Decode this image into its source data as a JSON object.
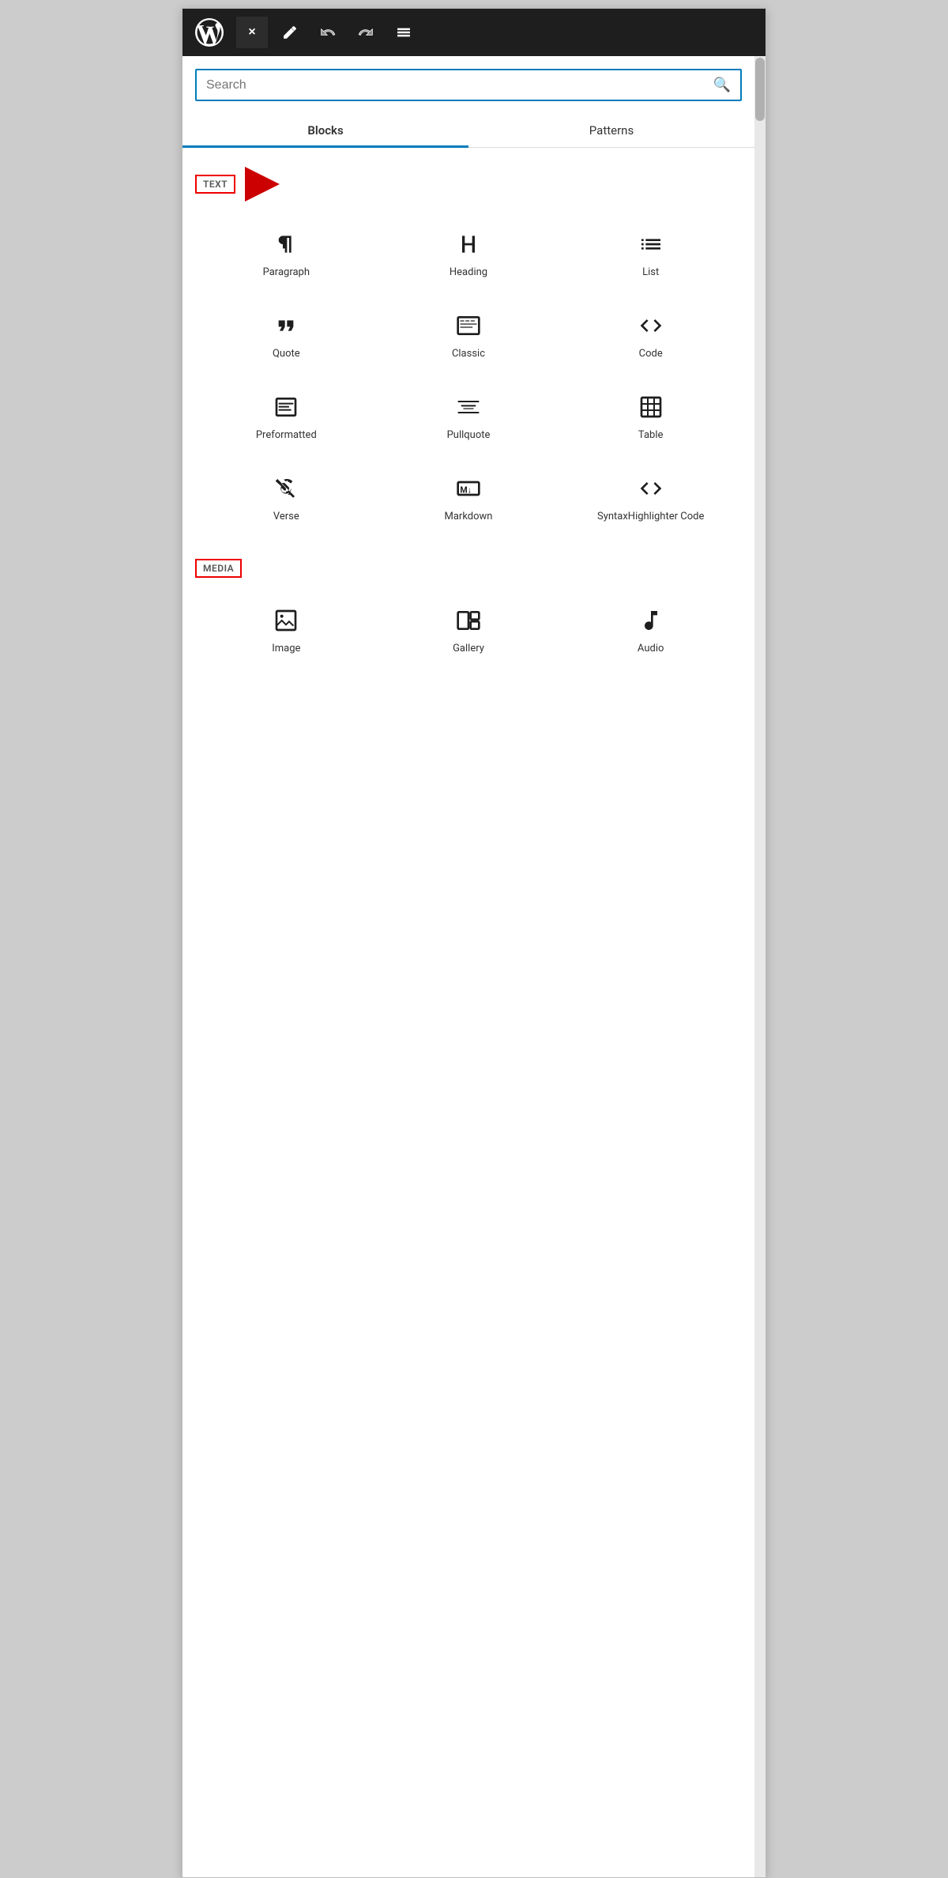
{
  "toolbar": {
    "close_label": "×",
    "pencil_icon": "✏",
    "undo_icon": "↩",
    "redo_icon": "↪",
    "menu_icon": "≡"
  },
  "search": {
    "placeholder": "Search",
    "icon": "⌕"
  },
  "tabs": [
    {
      "id": "blocks",
      "label": "Blocks",
      "active": true
    },
    {
      "id": "patterns",
      "label": "Patterns",
      "active": false
    }
  ],
  "sections": [
    {
      "id": "text",
      "label": "TEXT",
      "blocks": [
        {
          "id": "paragraph",
          "label": "Paragraph",
          "icon": "paragraph"
        },
        {
          "id": "heading",
          "label": "Heading",
          "icon": "heading"
        },
        {
          "id": "list",
          "label": "List",
          "icon": "list"
        },
        {
          "id": "quote",
          "label": "Quote",
          "icon": "quote"
        },
        {
          "id": "classic",
          "label": "Classic",
          "icon": "classic"
        },
        {
          "id": "code",
          "label": "Code",
          "icon": "code"
        },
        {
          "id": "preformatted",
          "label": "Preformatted",
          "icon": "preformatted"
        },
        {
          "id": "pullquote",
          "label": "Pullquote",
          "icon": "pullquote"
        },
        {
          "id": "table",
          "label": "Table",
          "icon": "table"
        },
        {
          "id": "verse",
          "label": "Verse",
          "icon": "verse"
        },
        {
          "id": "markdown",
          "label": "Markdown",
          "icon": "markdown"
        },
        {
          "id": "syntax",
          "label": "SyntaxHighlighter Code",
          "icon": "syntax"
        }
      ]
    },
    {
      "id": "media",
      "label": "MEDIA",
      "blocks": [
        {
          "id": "image",
          "label": "Image",
          "icon": "image"
        },
        {
          "id": "gallery",
          "label": "Gallery",
          "icon": "gallery"
        },
        {
          "id": "audio",
          "label": "Audio",
          "icon": "audio"
        }
      ]
    }
  ],
  "colors": {
    "accent_blue": "#007cba",
    "accent_red": "#cc0000",
    "toolbar_bg": "#1e1e1e"
  }
}
